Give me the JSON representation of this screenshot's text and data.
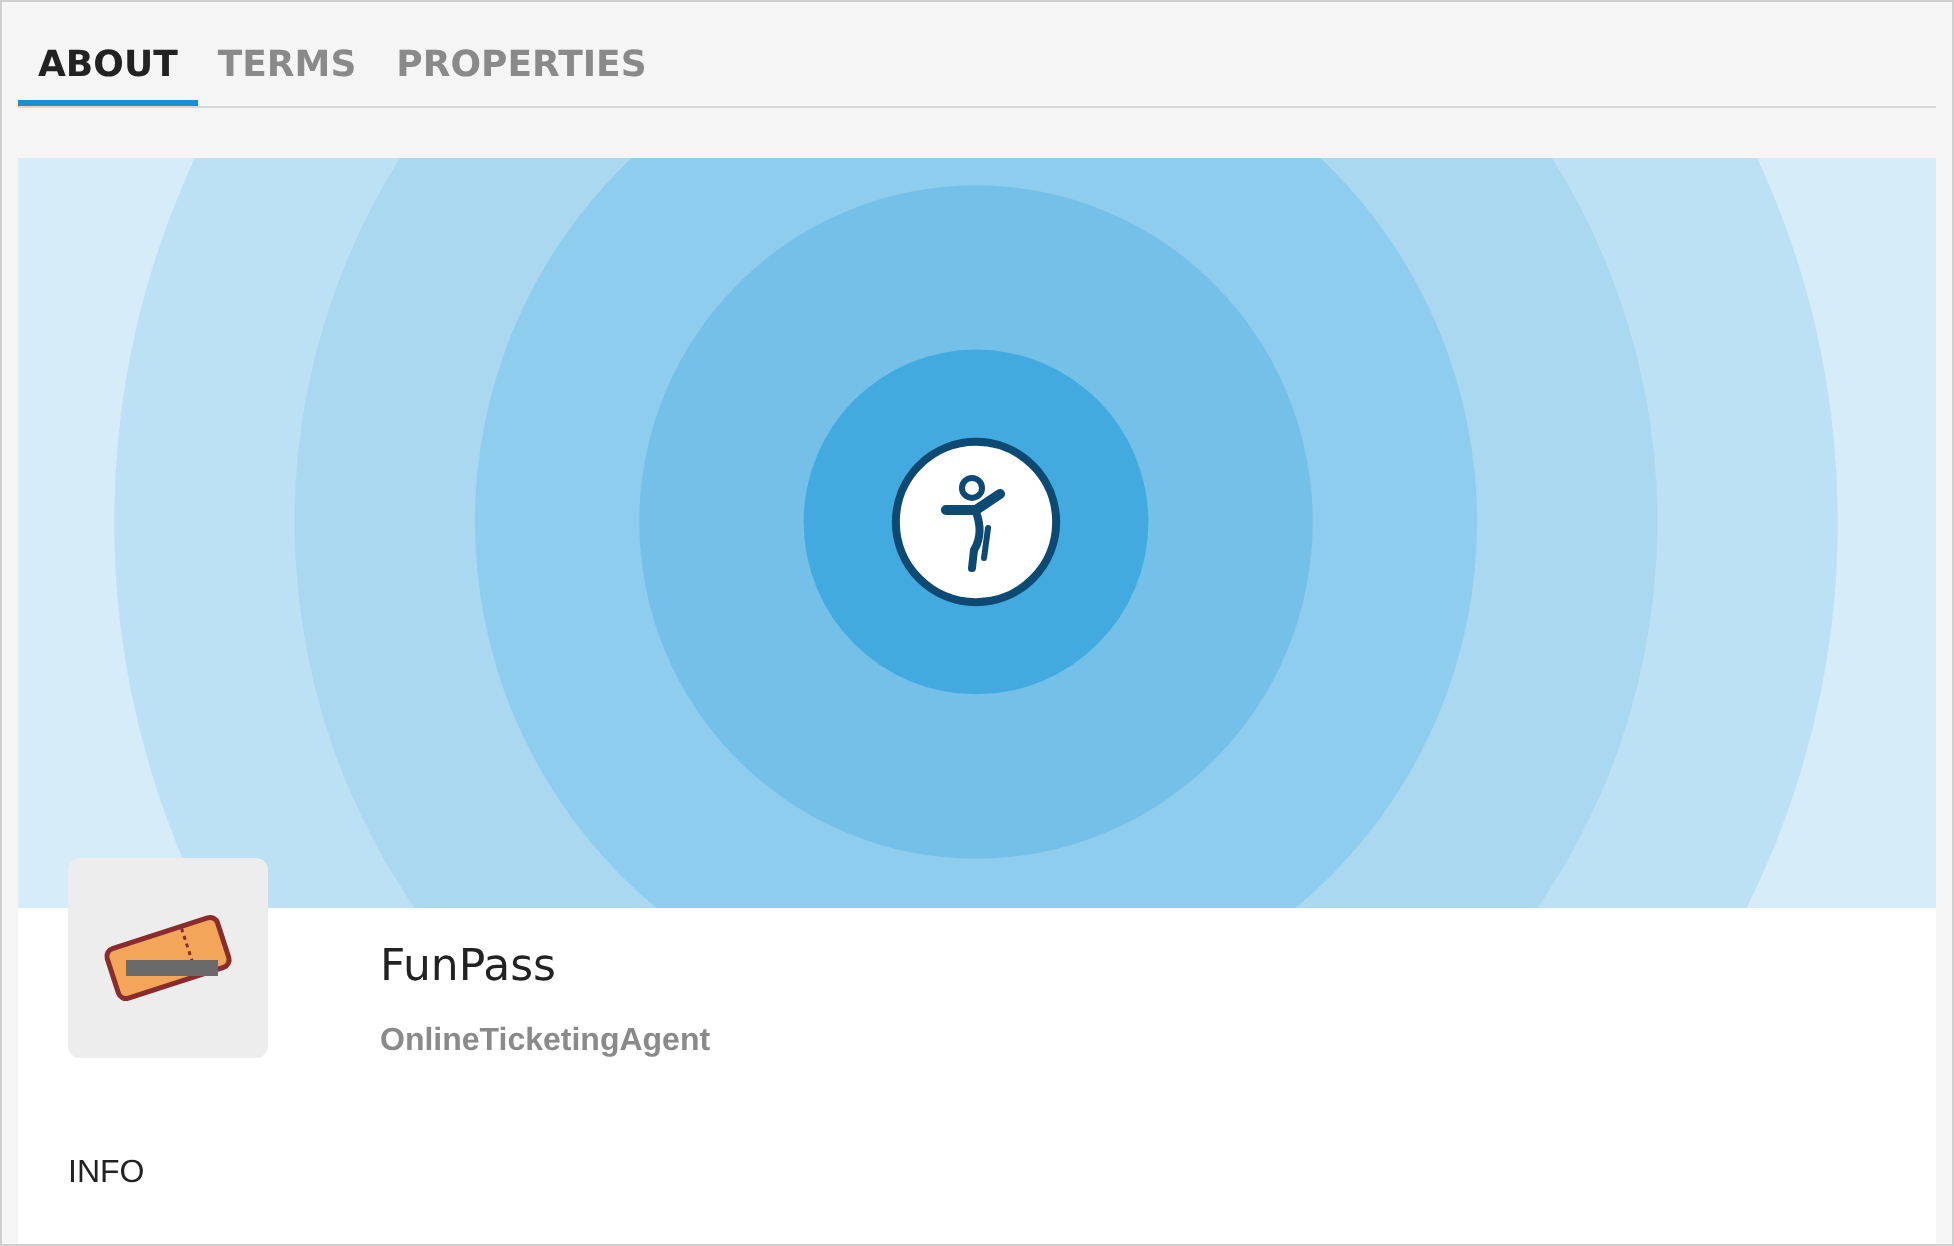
{
  "tabs": [
    {
      "label": "ABOUT",
      "selected": true
    },
    {
      "label": "TERMS",
      "selected": false
    },
    {
      "label": "PROPERTIES",
      "selected": false
    }
  ],
  "profile": {
    "name": "FunPass",
    "type": "OnlineTicketingAgent"
  },
  "section": {
    "title": "INFO"
  }
}
